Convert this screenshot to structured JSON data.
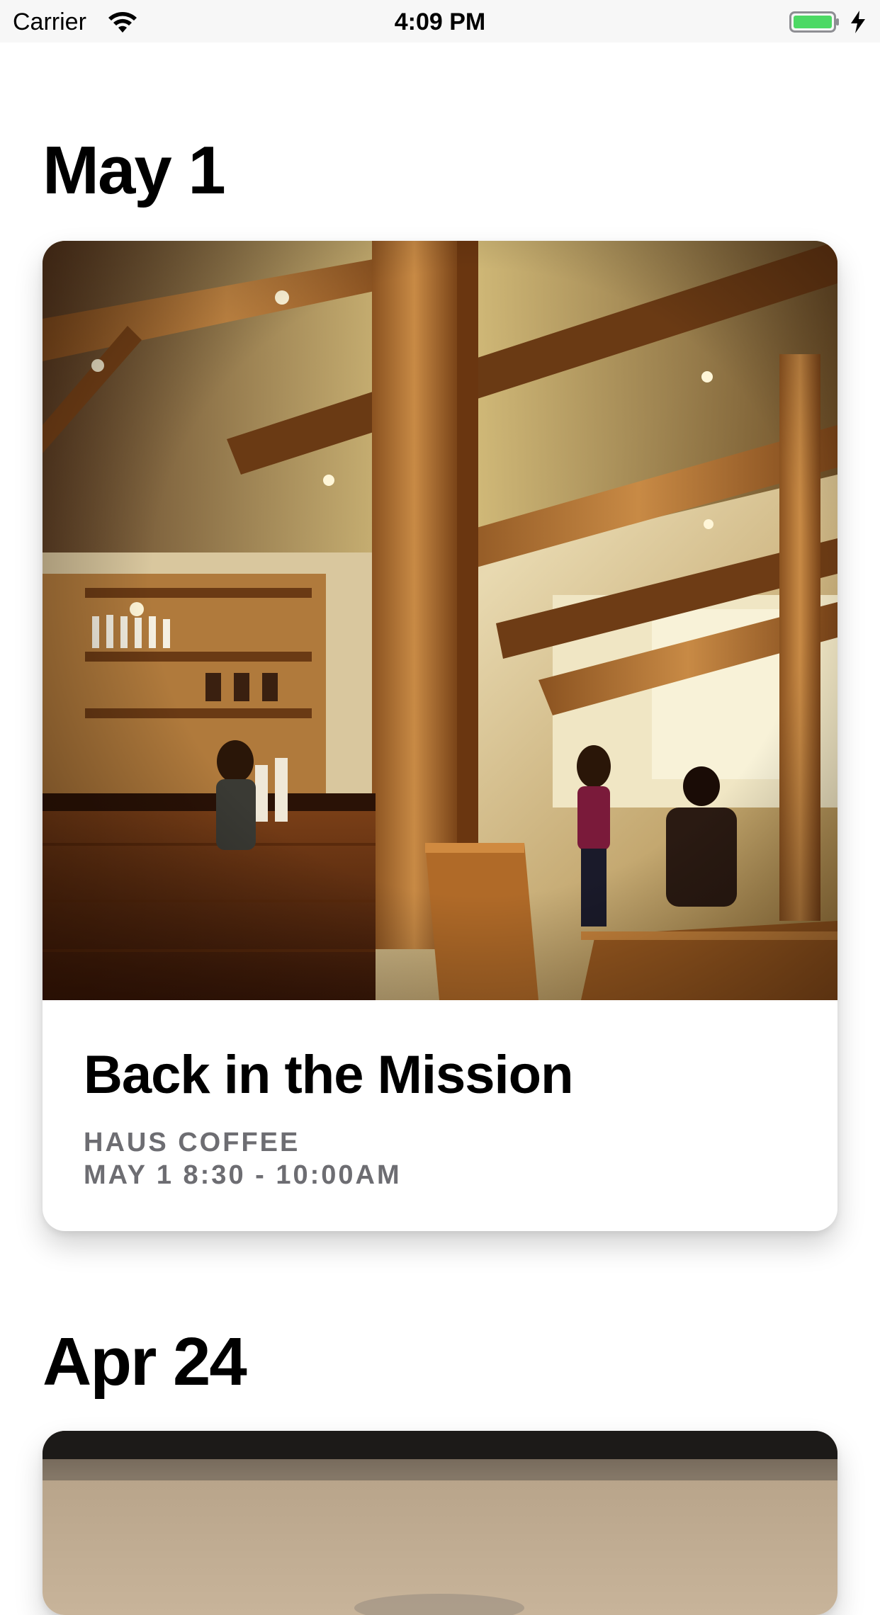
{
  "status_bar": {
    "carrier": "Carrier",
    "time": "4:09 PM",
    "wifi_icon": "wifi-icon",
    "battery_icon": "battery-icon",
    "charging_icon": "bolt-icon",
    "battery_color": "#4cd964"
  },
  "sections": [
    {
      "date": "May 1",
      "card": {
        "image": "cafe-interior-photo",
        "title": "Back in the Mission",
        "venue": "HAUS COFFEE",
        "time": "MAY 1 8:30 - 10:00AM"
      }
    },
    {
      "date": "Apr 24",
      "card": {
        "image": "coffee-table-photo"
      }
    }
  ],
  "colors": {
    "background": "#ffffff",
    "status_bar_bg": "#f7f7f7",
    "subtitle": "#6d6d72"
  }
}
